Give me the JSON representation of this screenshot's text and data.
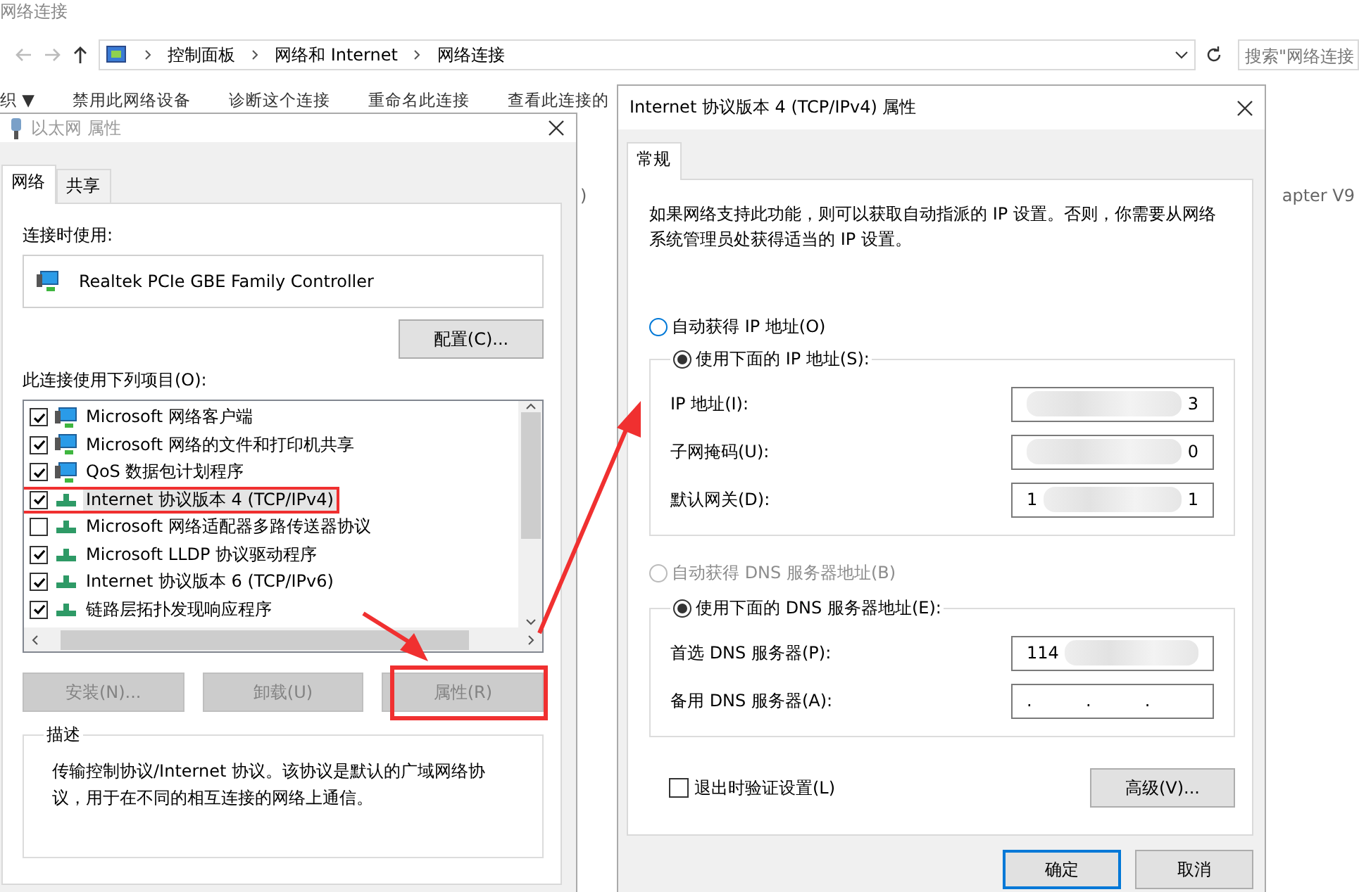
{
  "explorer": {
    "title": "网络连接",
    "address": [
      "控制面板",
      "网络和 Internet",
      "网络连接"
    ],
    "search_placeholder": "搜索\"网络连接",
    "toolbar": [
      "织 ▼",
      "禁用此网络设备",
      "诊断这个连接",
      "重命名此连接",
      "查看此连接的"
    ],
    "background_texts": [
      ")",
      "apter V9"
    ]
  },
  "ethernet_dialog": {
    "title": "以太网 属性",
    "tabs": [
      {
        "label": "网络",
        "selected": true
      },
      {
        "label": "共享",
        "selected": false
      }
    ],
    "connect_using_label": "连接时使用:",
    "adapter": "Realtek PCIe GBE Family Controller",
    "configure_button": "配置(C)...",
    "items_label": "此连接使用下列项目(O):",
    "items": [
      {
        "label": "Microsoft 网络客户端",
        "checked": true,
        "selected": false,
        "annotated": false,
        "kind": "client"
      },
      {
        "label": "Microsoft 网络的文件和打印机共享",
        "checked": true,
        "selected": false,
        "annotated": false,
        "kind": "client"
      },
      {
        "label": "QoS 数据包计划程序",
        "checked": true,
        "selected": false,
        "annotated": false,
        "kind": "client"
      },
      {
        "label": "Internet 协议版本 4 (TCP/IPv4)",
        "checked": true,
        "selected": true,
        "annotated": true,
        "kind": "protocol"
      },
      {
        "label": "Microsoft 网络适配器多路传送器协议",
        "checked": false,
        "selected": false,
        "annotated": false,
        "kind": "protocol"
      },
      {
        "label": "Microsoft LLDP 协议驱动程序",
        "checked": true,
        "selected": false,
        "annotated": false,
        "kind": "protocol"
      },
      {
        "label": "Internet 协议版本 6 (TCP/IPv6)",
        "checked": true,
        "selected": false,
        "annotated": false,
        "kind": "protocol"
      },
      {
        "label": "链路层拓扑发现响应程序",
        "checked": true,
        "selected": false,
        "annotated": false,
        "kind": "protocol"
      }
    ],
    "buttons": [
      {
        "label": "安装(N)...",
        "disabled": true,
        "annotated": false
      },
      {
        "label": "卸载(U)",
        "disabled": true,
        "annotated": false
      },
      {
        "label": "属性(R)",
        "disabled": true,
        "annotated": true
      }
    ],
    "description_title": "描述",
    "description": "传输控制协议/Internet 协议。该协议是默认的广域网络协议，用于在不同的相互连接的网络上通信。"
  },
  "ipv4_dialog": {
    "title": "Internet 协议版本 4 (TCP/IPv4) 属性",
    "tabs": [
      {
        "label": "常规",
        "selected": true
      }
    ],
    "intro": "如果网络支持此功能，则可以获取自动指派的 IP 设置。否则，你需要从网络系统管理员处获得适当的 IP 设置。",
    "ip_auto": {
      "label": "自动获得 IP 地址(O)",
      "selected": false,
      "disabled": false
    },
    "ip_manual": {
      "label": "使用下面的 IP 地址(S):",
      "selected": true,
      "disabled": false
    },
    "ip_fields": [
      {
        "label": "IP 地址(I):",
        "value_end": "3",
        "redacted": true
      },
      {
        "label": "子网掩码(U):",
        "value_end": "0",
        "redacted": true
      },
      {
        "label": "默认网关(D):",
        "value_start": "1",
        "value_end": "1",
        "redacted": true
      }
    ],
    "dns_auto": {
      "label": "自动获得 DNS 服务器地址(B)",
      "selected": false,
      "disabled": true
    },
    "dns_manual": {
      "label": "使用下面的 DNS 服务器地址(E):",
      "selected": true,
      "disabled": false
    },
    "dns_fields": [
      {
        "label": "首选 DNS 服务器(P):",
        "value_start": "114",
        "redacted": true
      },
      {
        "label": "备用 DNS 服务器(A):",
        "value_start": ".          .          .",
        "redacted": false
      }
    ],
    "validate_checkbox": {
      "label": "退出时验证设置(L)",
      "checked": false
    },
    "advanced_button": "高级(V)...",
    "ok_button": "确定",
    "cancel_button": "取消"
  }
}
